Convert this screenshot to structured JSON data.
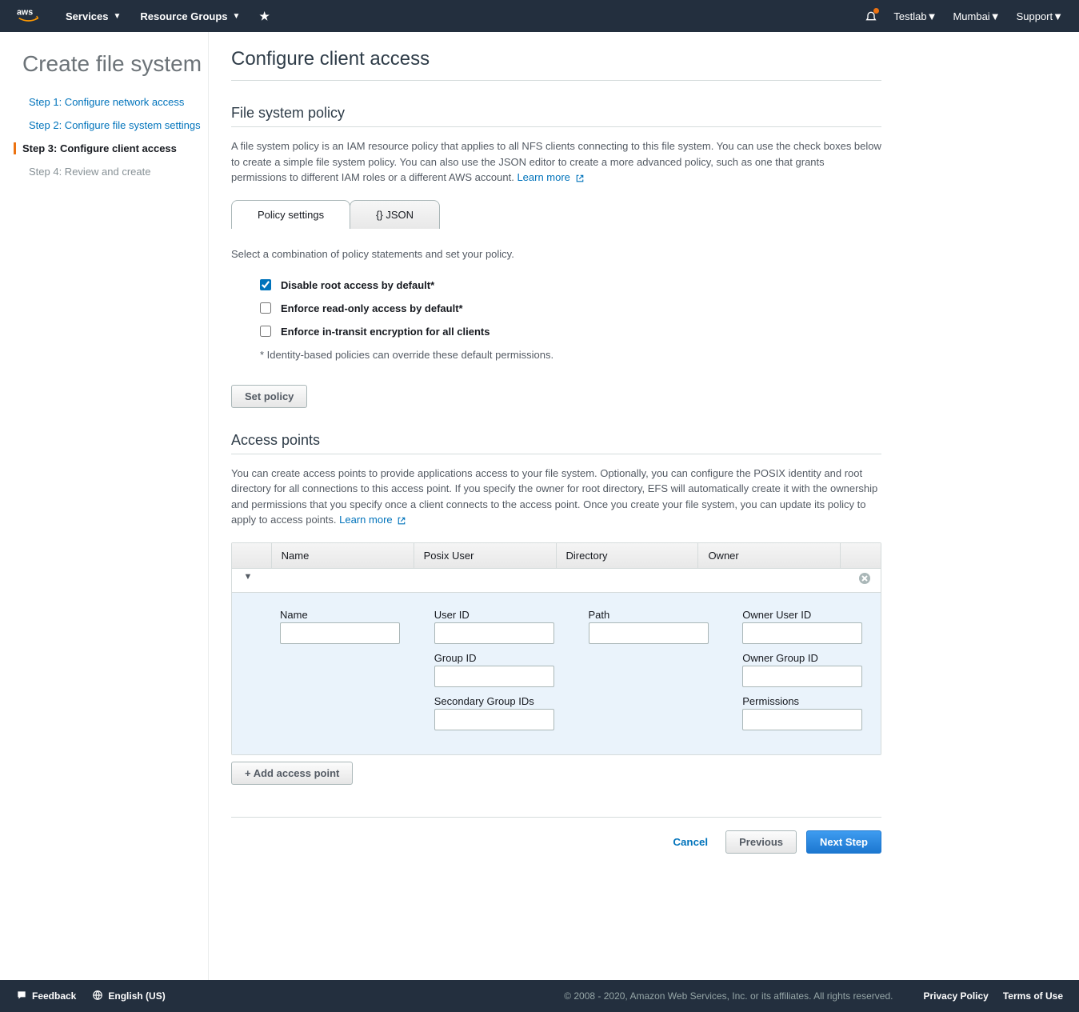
{
  "topnav": {
    "services": "Services",
    "resource_groups": "Resource Groups",
    "account": "Testlab",
    "region": "Mumbai",
    "support": "Support"
  },
  "page_title": "Create file system",
  "steps": [
    {
      "label": "Step 1: Configure network access",
      "state": "completed"
    },
    {
      "label": "Step 2: Configure file system settings",
      "state": "completed"
    },
    {
      "label": "Step 3: Configure client access",
      "state": "active"
    },
    {
      "label": "Step 4: Review and create",
      "state": "pending"
    }
  ],
  "main_heading": "Configure client access",
  "fsp": {
    "title": "File system policy",
    "desc": "A file system policy is an IAM resource policy that applies to all NFS clients connecting to this file system. You can use the check boxes below to create a simple file system policy. You can also use the JSON editor to create a more advanced policy, such as one that grants permissions to different IAM roles or a different AWS account.",
    "learn_more": "Learn more",
    "tabs": {
      "settings": "Policy settings",
      "json": "{} JSON"
    },
    "instructions": "Select a combination of policy statements and set your policy.",
    "checks": [
      {
        "label": "Disable root access by default*",
        "checked": true
      },
      {
        "label": "Enforce read-only access by default*",
        "checked": false
      },
      {
        "label": "Enforce in-transit encryption for all clients",
        "checked": false
      }
    ],
    "footnote": "* Identity-based policies can override these default permissions.",
    "set_policy": "Set policy"
  },
  "ap": {
    "title": "Access points",
    "desc": "You can create access points to provide applications access to your file system. Optionally, you can configure the POSIX identity and root directory for all connections to this access point. If you specify the owner for root directory, EFS will automatically create it with the ownership and permissions that you specify once a client connects to the access point. Once you create your file system, you can update its policy to apply to access points.",
    "learn_more": "Learn more",
    "headers": {
      "name": "Name",
      "posix": "Posix User",
      "directory": "Directory",
      "owner": "Owner"
    },
    "fields": {
      "name": "Name",
      "user_id": "User ID",
      "group_id": "Group ID",
      "secondary_gids": "Secondary Group IDs",
      "path": "Path",
      "owner_uid": "Owner User ID",
      "owner_gid": "Owner Group ID",
      "permissions": "Permissions"
    },
    "add_button": "+ Add access point"
  },
  "footer_buttons": {
    "cancel": "Cancel",
    "previous": "Previous",
    "next": "Next Step"
  },
  "bottombar": {
    "feedback": "Feedback",
    "language": "English (US)",
    "copyright": "© 2008 - 2020, Amazon Web Services, Inc. or its affiliates. All rights reserved.",
    "privacy": "Privacy Policy",
    "terms": "Terms of Use"
  }
}
